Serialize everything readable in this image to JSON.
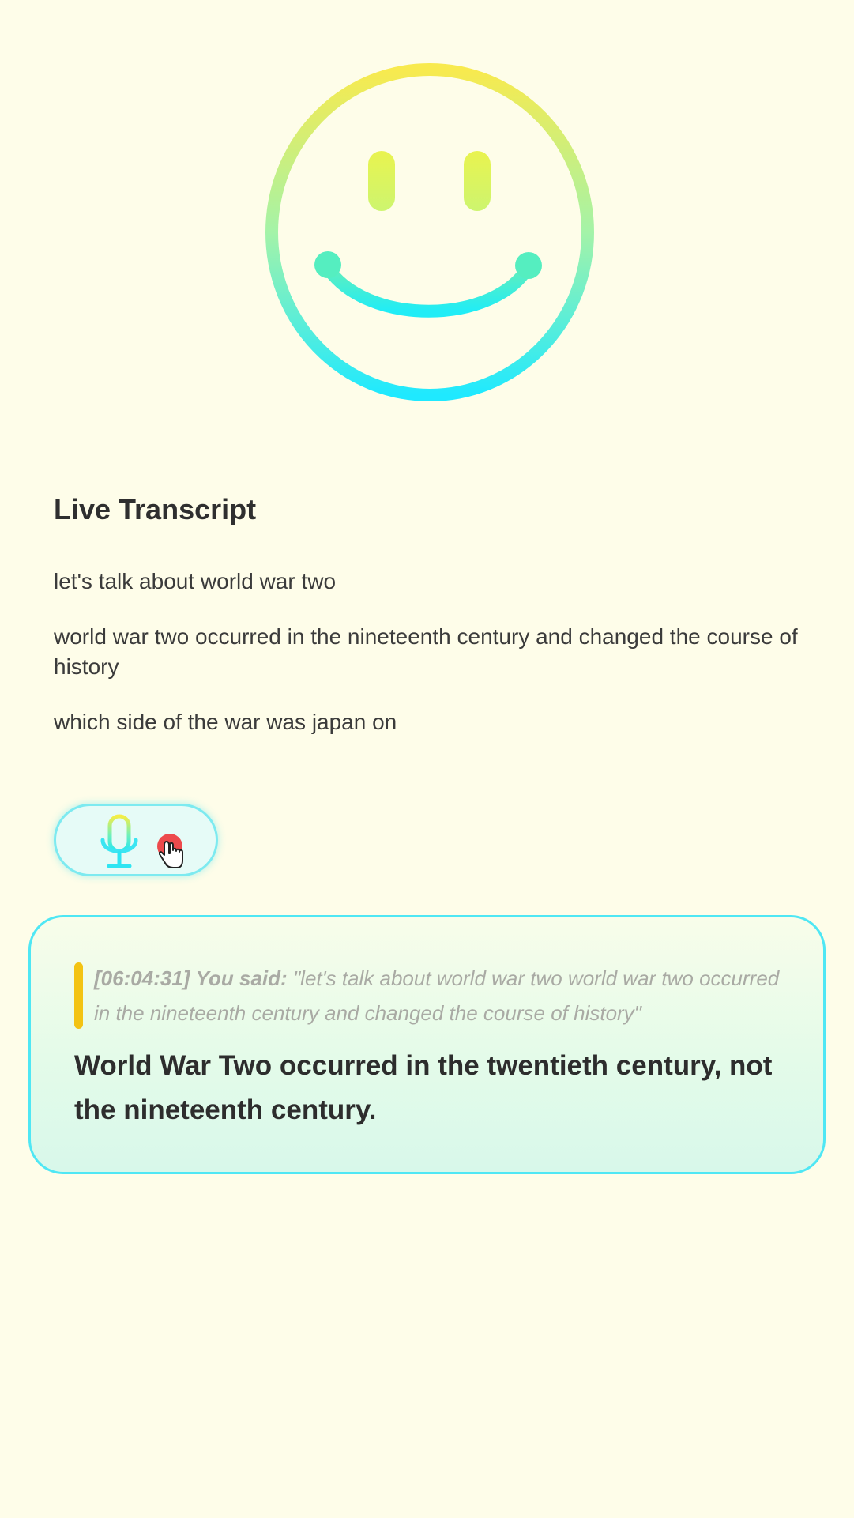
{
  "transcript": {
    "title": "Live Transcript",
    "lines": [
      "let's talk about world war two",
      "world war two occurred in the nineteenth century and changed the course of history",
      "which side of the war was japan on"
    ]
  },
  "controls": {
    "mic_icon": "microphone-icon",
    "recording_indicator": "red-dot",
    "cursor_icon": "hand-pointer-icon"
  },
  "response": {
    "timestamp": "[06:04:31]",
    "speaker_label": "You said:",
    "quote": "\"let's talk about world war two world war two occurred in the nineteenth century and changed the course of history\"",
    "message": "World War Two occurred in the twentieth century, not the nineteenth century."
  },
  "colors": {
    "background": "#fefde9",
    "accent_cyan": "#25eef5",
    "accent_yellow": "#f8ea4e",
    "quote_bar": "#f3c313",
    "recording_red": "#ed4a4c",
    "card_border": "#4fe7f4"
  }
}
